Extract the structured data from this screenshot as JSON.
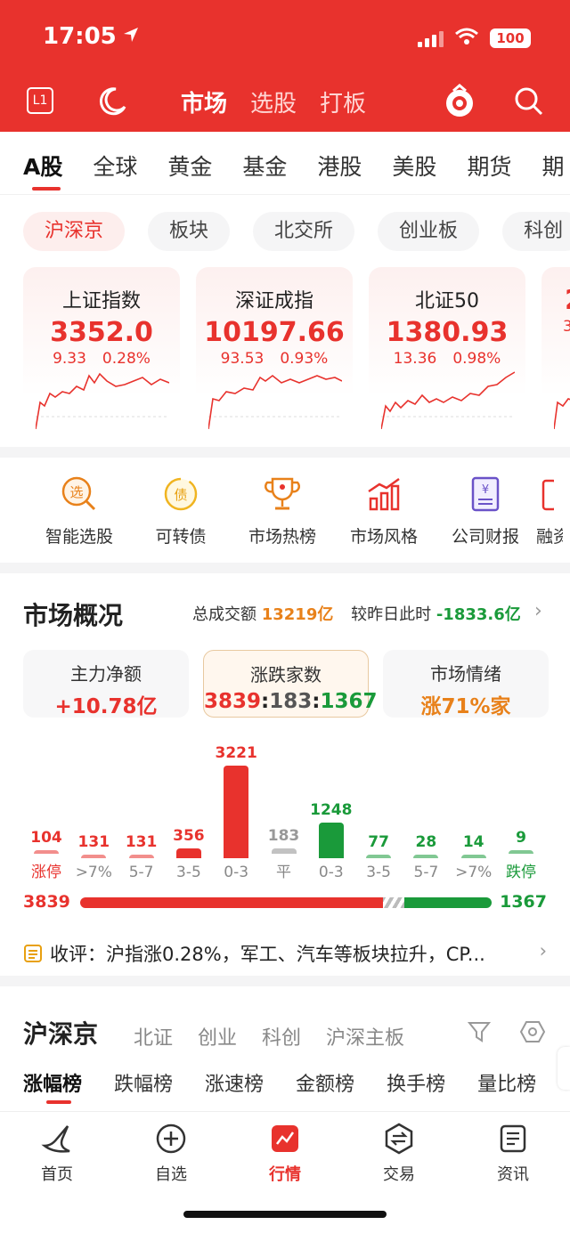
{
  "status_bar": {
    "time": "17:05",
    "battery": "100"
  },
  "top_nav": {
    "badge": "L1",
    "tabs": [
      "市场",
      "选股",
      "打板"
    ],
    "active_tab": "市场"
  },
  "market_tabs": [
    "A股",
    "全球",
    "黄金",
    "基金",
    "港股",
    "美股",
    "期货",
    "期"
  ],
  "filter_pills": [
    "沪深京",
    "板块",
    "北交所",
    "创业板",
    "科创"
  ],
  "index_cards": [
    {
      "name": "上证指数",
      "value": "3352.0",
      "change": "9.33",
      "pct": "0.28%"
    },
    {
      "name": "深证成指",
      "value": "10197.66",
      "change": "93.53",
      "pct": "0.93%"
    },
    {
      "name": "北证50",
      "value": "1380.93",
      "change": "13.36",
      "pct": "0.98%"
    },
    {
      "name": "",
      "value": "2",
      "change": "3",
      "pct": ""
    }
  ],
  "tools": [
    {
      "label": "智能选股",
      "icon": "smart-pick-icon"
    },
    {
      "label": "可转债",
      "icon": "convertible-bond-icon"
    },
    {
      "label": "市场热榜",
      "icon": "trophy-icon"
    },
    {
      "label": "市场风格",
      "icon": "bar-style-icon"
    },
    {
      "label": "公司财报",
      "icon": "financial-report-icon"
    },
    {
      "label": "融资",
      "icon": "margin-icon"
    }
  ],
  "overview": {
    "title": "市场概况",
    "turnover_label": "总成交额",
    "turnover": "13219亿",
    "vs_label": "较昨日此时",
    "vs_value": "-1833.6亿",
    "boxes": [
      {
        "title": "主力净额",
        "value": "+10.78亿"
      },
      {
        "title": "涨跌家数",
        "value_up": "3839",
        "value_flat": "183",
        "value_down": "1367",
        "sep": ":"
      },
      {
        "title": "市场情绪",
        "value": "涨71%家"
      }
    ],
    "distribution": [
      {
        "label": "涨停",
        "count": "104",
        "value": 104,
        "color": "#e8322d"
      },
      {
        "label": ">7%",
        "count": "131",
        "value": 131,
        "color": "#e8322d"
      },
      {
        "label": "5-7",
        "count": "131",
        "value": 131,
        "color": "#e8322d"
      },
      {
        "label": "3-5",
        "count": "356",
        "value": 356,
        "color": "#e8322d"
      },
      {
        "label": "0-3",
        "count": "3221",
        "value": 3221,
        "color": "#e8322d"
      },
      {
        "label": "平",
        "count": "183",
        "value": 183,
        "color": "#999999"
      },
      {
        "label": "0-3",
        "count": "1248",
        "value": 1248,
        "color": "#1a9a3a"
      },
      {
        "label": "3-5",
        "count": "77",
        "value": 77,
        "color": "#1a9a3a"
      },
      {
        "label": "5-7",
        "count": "28",
        "value": 28,
        "color": "#1a9a3a"
      },
      {
        "label": ">7%",
        "count": "14",
        "value": 14,
        "color": "#1a9a3a"
      },
      {
        "label": "跌停",
        "count": "9",
        "value": 9,
        "color": "#1a9a3a"
      }
    ],
    "up_total": "3839",
    "down_total": "1367",
    "comment": "收评：沪指涨0.28%，军工、汽车等板块拉升，CP..."
  },
  "ranking": {
    "title": "沪深京",
    "tabs": [
      "北证",
      "创业",
      "科创",
      "沪深主板"
    ],
    "sub_tabs": [
      "涨幅榜",
      "跌幅榜",
      "涨速榜",
      "金额榜",
      "换手榜",
      "量比榜"
    ]
  },
  "bottom_nav": [
    {
      "label": "首页",
      "icon": "home-icon"
    },
    {
      "label": "自选",
      "icon": "add-watchlist-icon"
    },
    {
      "label": "行情",
      "icon": "market-chart-icon"
    },
    {
      "label": "交易",
      "icon": "trade-icon"
    },
    {
      "label": "资讯",
      "icon": "news-icon"
    }
  ],
  "colors": {
    "brand_red": "#e8322d",
    "down_green": "#1a9a3a",
    "orange": "#e8811a"
  }
}
